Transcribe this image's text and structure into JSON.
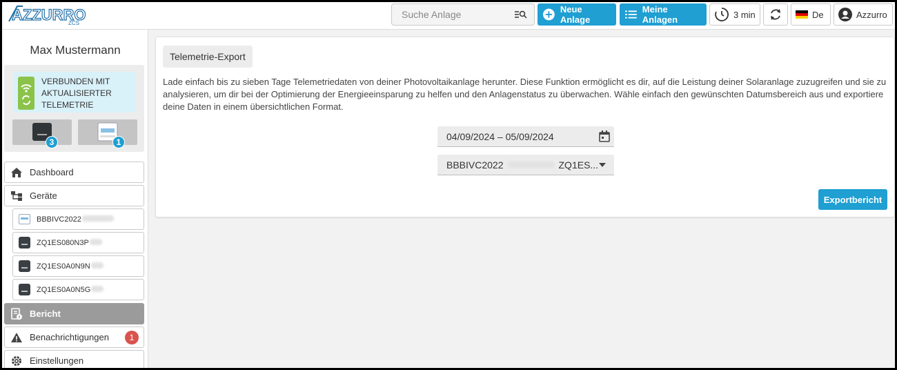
{
  "header": {
    "logo_text": "AZZURRO",
    "logo_sub": "ZCS",
    "search_placeholder": "Suche Anlage",
    "new_plant_label": "Neue Anlage",
    "my_plants_label": "Meine Anlagen",
    "refresh_interval_label": "3 min",
    "language_label": "De",
    "user_label": "Azzurro"
  },
  "sidebar": {
    "user_name": "Max Mustermann",
    "connection_status": "VERBUNDEN MIT AKTUALISIERTER TELEMETRIE",
    "inverter_count": "3",
    "battery_count": "1",
    "nav": {
      "dashboard": "Dashboard",
      "devices": "Geräte",
      "report": "Bericht",
      "notifications": "Benachrichtigungen",
      "notifications_count": "1",
      "settings": "Einstellungen"
    },
    "devices": [
      {
        "name": "BBBIVC2022",
        "icon": "battery-icon"
      },
      {
        "name": "ZQ1ES080N3P",
        "icon": "inverter-icon"
      },
      {
        "name": "ZQ1ES0A0N9N",
        "icon": "inverter-icon"
      },
      {
        "name": "ZQ1ES0A0N5G",
        "icon": "inverter-icon"
      }
    ]
  },
  "main": {
    "title": "Telemetrie-Export",
    "description": "Lade einfach bis zu sieben Tage Telemetriedaten von deiner Photovoltaikanlage herunter. Diese Funktion ermöglicht es dir, auf die Leistung deiner Solaranlage zuzugreifen und sie zu analysieren, um dir bei der Optimierung der Energieeinsparung zu helfen und den Anlagenstatus zu überwachen. Wähle einfach den gewünschten Datumsbereich aus und exportiere deine Daten in einem übersichtlichen Format.",
    "date_range": "04/09/2024 – 05/09/2024",
    "device_select_prefix": "BBBIVC2022",
    "device_select_suffix": "ZQ1ES...",
    "export_button": "Exportbericht"
  },
  "colors": {
    "accent": "#1f9fd2",
    "active_nav": "#9b9b9b",
    "alert": "#d9534f",
    "connected": "#8bc34a"
  }
}
